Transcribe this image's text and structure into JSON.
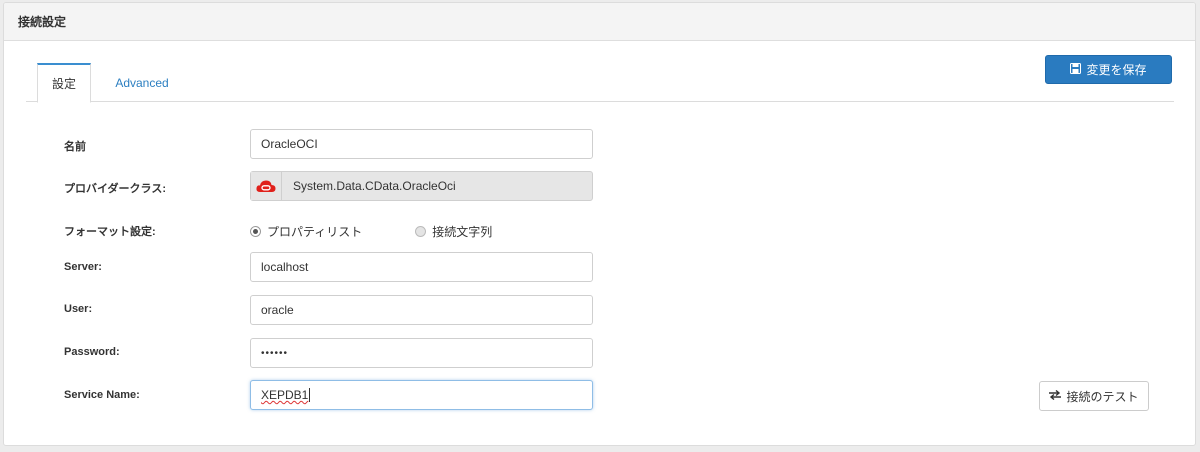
{
  "panel": {
    "title": "接続設定"
  },
  "tabs": [
    {
      "label": "設定",
      "active": true
    },
    {
      "label": "Advanced",
      "active": false
    }
  ],
  "buttons": {
    "save": {
      "label": "変更を保存",
      "icon": "save-icon"
    },
    "test": {
      "label": "接続のテスト",
      "icon": "swap-arrows-icon"
    }
  },
  "form": {
    "name": {
      "label": "名前",
      "value": "OracleOCI"
    },
    "provider": {
      "label": "プロバイダークラス:",
      "value": "System.Data.CData.OracleOci",
      "icon": "oracle-cloud-icon"
    },
    "format": {
      "label": "フォーマット設定:",
      "options": [
        {
          "label": "プロパティリスト",
          "checked": true
        },
        {
          "label": "接続文字列",
          "checked": false
        }
      ]
    },
    "server": {
      "label": "Server:",
      "value": "localhost"
    },
    "user": {
      "label": "User:",
      "value": "oracle"
    },
    "password": {
      "label": "Password:",
      "value": "••••••"
    },
    "service_name": {
      "label": "Service Name:",
      "value": "XEPDB1"
    }
  },
  "colors": {
    "accent": "#2a7bc0",
    "tab_link": "#2c7fc1",
    "oracle_red": "#e0201b"
  }
}
